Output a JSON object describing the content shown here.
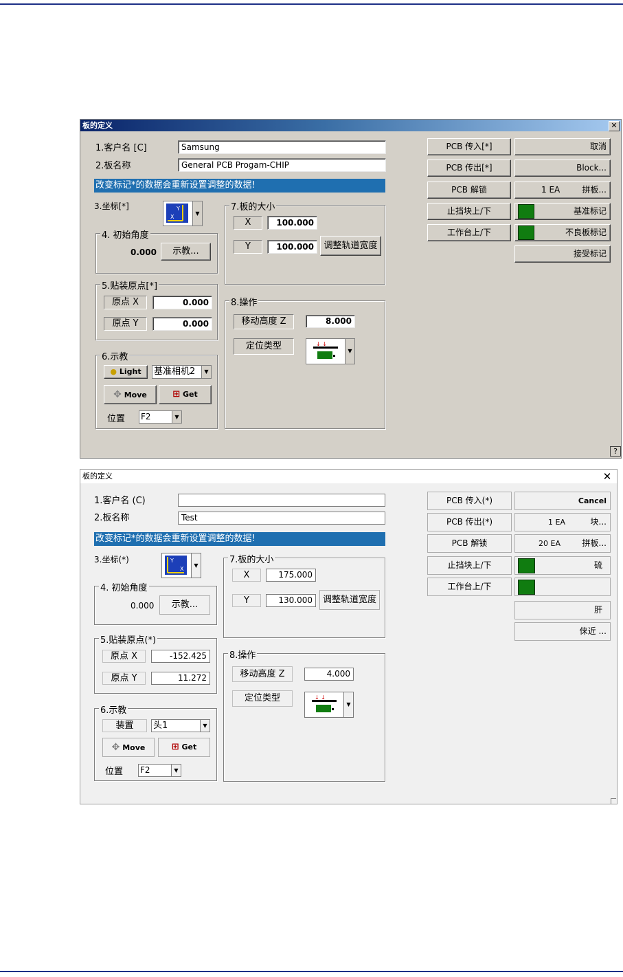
{
  "window1": {
    "title": "板的定义",
    "customer_label": "1.客户名 [C]",
    "customer_value": "Samsung",
    "board_label": "2.板名称",
    "board_value": "General PCB Progam-CHIP",
    "banner": "改变标记*的数据会重新设置调整的数据!",
    "coord_label": "3.坐标[*]",
    "angle_group": "4. 初始角度",
    "angle_value": "0.000",
    "teach_btn": "示教...",
    "origin_group": "5.贴装原点[*]",
    "origin_x_label": "原点 X",
    "origin_x_value": "0.000",
    "origin_y_label": "原点 Y",
    "origin_y_value": "0.000",
    "teach_group": "6.示教",
    "light_btn": "Light",
    "camera_select": "基准相机2",
    "move_btn": "Move",
    "get_btn": "Get",
    "position_label": "位置",
    "position_select": "F2",
    "size_group": "7.板的大小",
    "size_x_label": "X",
    "size_x_value": "100.000",
    "size_y_label": "Y",
    "size_y_value": "100.000",
    "adjust_btn": "调整轨道宽度",
    "op_group": "8.操作",
    "move_height_label": "移动高度 Z",
    "move_height_value": "8.000",
    "locate_label": "定位类型",
    "right_buttons": {
      "pcb_in": "PCB 传入[*]",
      "pcb_out": "PCB 传出[*]",
      "pcb_unlock": "PCB 解锁",
      "stop_block": "止挡块上/下",
      "table": "工作台上/下",
      "cancel": "取消",
      "block": "Block...",
      "array_count": "1 EA",
      "array": "拼板...",
      "fiducial": "基准标记",
      "bad_mark": "不良板标记",
      "accept_mark": "接受标记"
    },
    "help": "?"
  },
  "window2": {
    "title": "板的定义",
    "customer_label": "1.客户名 (C)",
    "customer_value": "",
    "board_label": "2.板名称",
    "board_value": "Test",
    "banner": "改变标记*的数据会重新设置调整的数据!",
    "coord_label": "3.坐标(*)",
    "angle_group": "4. 初始角度",
    "angle_value": "0.000",
    "teach_btn": "示教...",
    "origin_group": "5.贴装原点(*)",
    "origin_x_label": "原点 X",
    "origin_x_value": "-152.425",
    "origin_y_label": "原点 Y",
    "origin_y_value": "11.272",
    "teach_group": "6.示教",
    "device_label": "装置",
    "device_select": "头1",
    "move_btn": "Move",
    "get_btn": "Get",
    "position_label": "位置",
    "position_select": "F2",
    "size_group": "7.板的大小",
    "size_x_label": "X",
    "size_x_value": "175.000",
    "size_y_label": "Y",
    "size_y_value": "130.000",
    "adjust_btn": "调整轨道宽度",
    "op_group": "8.操作",
    "move_height_label": "移动高度 Z",
    "move_height_value": "4.000",
    "locate_label": "定位类型",
    "right_buttons": {
      "pcb_in": "PCB 传入(*)",
      "pcb_out": "PCB 传出(*)",
      "pcb_unlock": "PCB 解锁",
      "stop_block": "止挡块上/下",
      "table": "工作台上/下",
      "cancel": "Cancel",
      "block_count": "1 EA",
      "block": "块...",
      "array_count": "20 EA",
      "array": "拼板...",
      "fiducial": "硫",
      "bad_mark": "",
      "accept_mark": "肝",
      "approach": "俫近 ..."
    }
  }
}
